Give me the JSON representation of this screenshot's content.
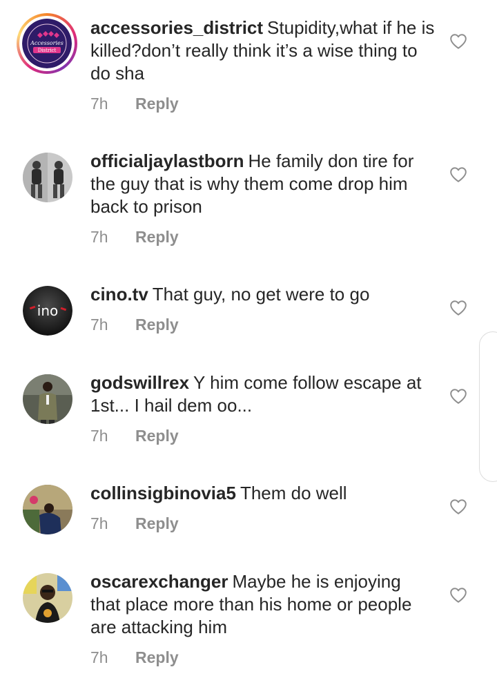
{
  "comments": [
    {
      "username": "accessories_district",
      "text": "Stupidity,what if he is killed?don’t really think it’s a wise thing to do sha",
      "time": "7h",
      "reply_label": "Reply",
      "avatar_logo_text": "Accessories District"
    },
    {
      "username": "officialjaylastborn",
      "text": "He family don tire for the guy that is why them come drop him back to prison",
      "time": "7h",
      "reply_label": "Reply"
    },
    {
      "username": "cino.tv",
      "text": "That guy, no get were to go",
      "time": "7h",
      "reply_label": "Reply",
      "avatar_logo_text": "ino"
    },
    {
      "username": "godswillrex",
      "text": "Y him come follow escape at 1st... I hail dem oo...",
      "time": "7h",
      "reply_label": "Reply"
    },
    {
      "username": "collinsigbinovia5",
      "text": "Them do well",
      "time": "7h",
      "reply_label": "Reply"
    },
    {
      "username": "oscarexchanger",
      "text": "Maybe he is enjoying that place more than his home or people are attacking him",
      "time": "7h",
      "reply_label": "Reply"
    }
  ],
  "icons": {
    "like": "heart-outline-icon"
  },
  "colors": {
    "text": "#262626",
    "meta": "#8e8e8e",
    "heart_stroke": "#8e8e8e"
  }
}
